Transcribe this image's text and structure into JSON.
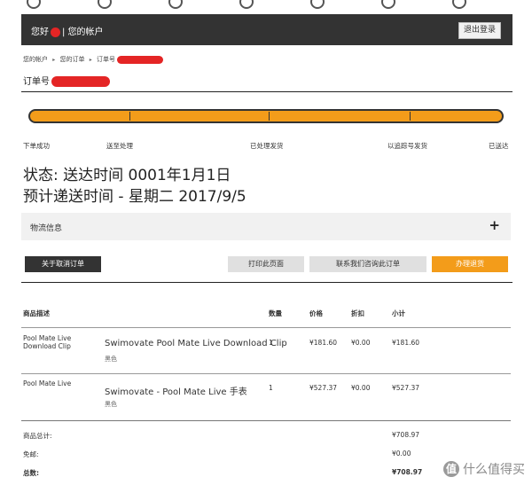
{
  "header": {
    "greeting_prefix": "您好",
    "greeting_suffix": "| 您的帐户",
    "logout_label": "退出登录"
  },
  "breadcrumb": {
    "items": [
      "您的帐户",
      "您的订单",
      "订单号"
    ],
    "separator": "▸"
  },
  "order": {
    "number_label": "订单号"
  },
  "progress": {
    "fill_fraction": 1.0,
    "color": "#f39c1a",
    "steps": [
      "下单成功",
      "送至处理",
      "已处理发货",
      "以追踪号发货",
      "已送达"
    ]
  },
  "status": {
    "line1": "状态: 送达时间 0001年1月1日",
    "line2": "预计递送时间 - 星期二 2017/9/5"
  },
  "logistics": {
    "label": "物流信息",
    "expand_icon": "plus-icon"
  },
  "actions": {
    "cancel_label": "关于取消订单",
    "print_label": "打印此页面",
    "contact_label": "联系我们咨询此订单",
    "return_label": "办理退货"
  },
  "table": {
    "headers": {
      "desc": "商品描述",
      "qty": "数量",
      "price": "价格",
      "discount": "折扣",
      "subtotal": "小计"
    },
    "rows": [
      {
        "sku": "Pool Mate Live Download Clip",
        "name": "Swimovate Pool Mate Live Download Clip",
        "color": "黑色",
        "qty": "1",
        "price": "¥181.60",
        "discount": "¥0.00",
        "subtotal": "¥181.60"
      },
      {
        "sku": "Pool Mate Live",
        "name": "Swimovate - Pool Mate Live 手表",
        "color": "黑色",
        "qty": "1",
        "price": "¥527.37",
        "discount": "¥0.00",
        "subtotal": "¥527.37"
      }
    ]
  },
  "summary": {
    "items_total_label": "商品总计:",
    "items_total": "¥708.97",
    "shipping_label": "免邮:",
    "shipping": "¥0.00",
    "total_label": "总数:",
    "total": "¥708.97"
  },
  "watermark": {
    "icon_char": "值",
    "text": "什么值得买"
  },
  "colors": {
    "accent": "#f39c1a",
    "dark": "#333333",
    "redaction": "#e42525"
  }
}
